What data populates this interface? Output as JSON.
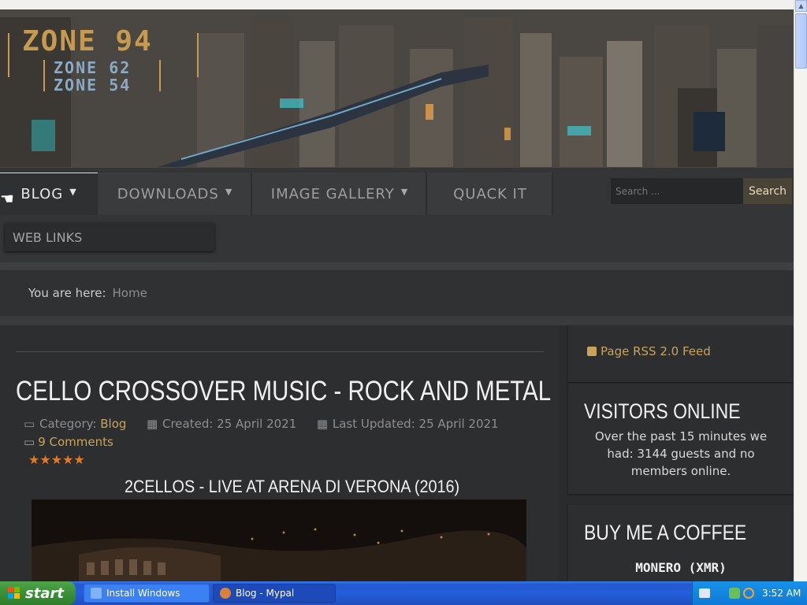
{
  "header": {
    "logo_main": "ZONE 94",
    "logo_sub1": "ZONE 62",
    "logo_sub2": "ZONE 54"
  },
  "nav": {
    "items": [
      {
        "label": "BLOG"
      },
      {
        "label": "DOWNLOADS"
      },
      {
        "label": "IMAGE GALLERY"
      },
      {
        "label": "QUACK IT"
      },
      {
        "label": "WEB LINKS"
      }
    ],
    "caret": "▼"
  },
  "search": {
    "placeholder": "Search ...",
    "button": "Search"
  },
  "breadcrumb": {
    "label": "You are here:",
    "home": "Home"
  },
  "article": {
    "title": "CELLO CROSSOVER MUSIC - ROCK AND METAL",
    "category_label": "Category:",
    "category_link": "Blog",
    "created": "Created: 25 April 2021",
    "updated": "Last Updated: 25 April 2021",
    "comments": "9 Comments",
    "stars": "★★★★★",
    "rating": 5,
    "video_title": "2CELLOS - LIVE AT ARENA DI VERONA (2016)"
  },
  "sidebar": {
    "rss": "Page RSS 2.0 Feed",
    "visitors_title": "VISITORS ONLINE",
    "visitors_text": "Over the past 15 minutes we had: 3144 guests and no members online.",
    "coffee_title": "BUY ME A COFFEE",
    "monero": "MONERO (XMR)"
  },
  "taskbar": {
    "start": "start",
    "tasks": [
      {
        "label": "Install Windows"
      },
      {
        "label": "Blog - Mypal"
      }
    ],
    "clock": "3:52 AM"
  },
  "colors": {
    "accent": "#c9a35a",
    "star": "#e07a2a",
    "background": "#2b2c2d"
  }
}
